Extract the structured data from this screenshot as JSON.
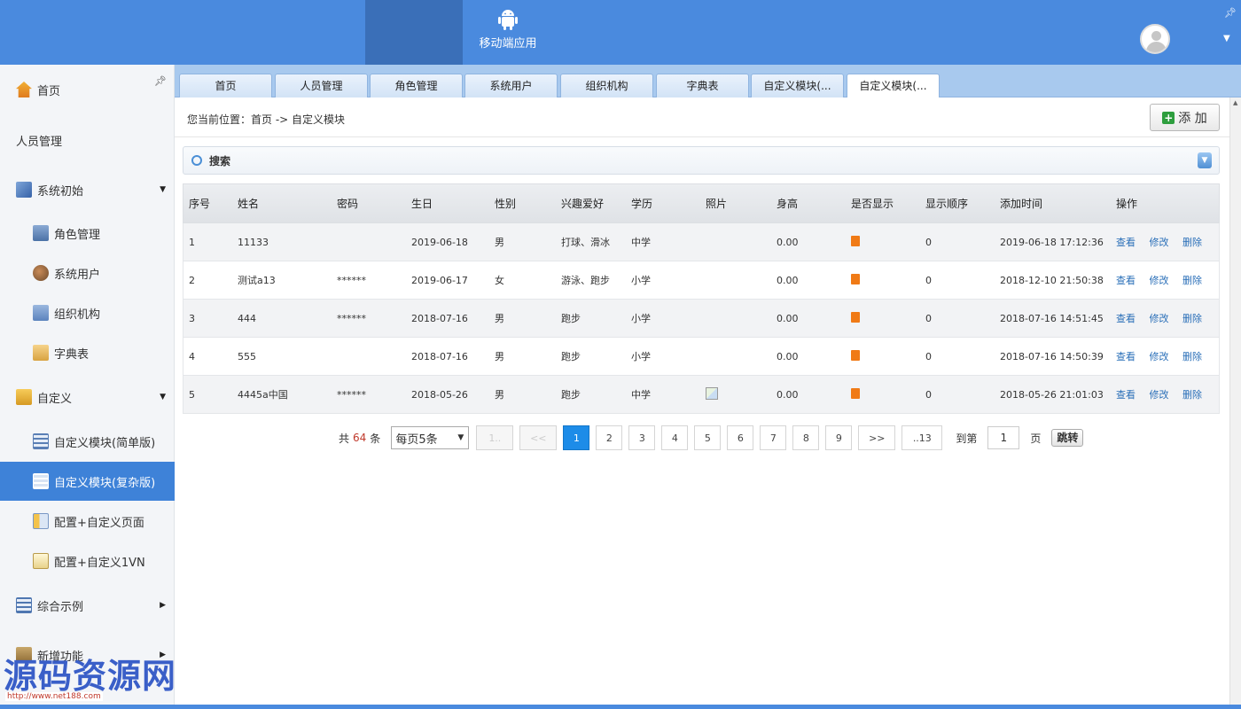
{
  "topbar": {
    "mobile_label": "移动端应用"
  },
  "sidebar": {
    "items": [
      {
        "label": "首页",
        "icon": "home-icon"
      },
      {
        "label": "人员管理",
        "icon": ""
      },
      {
        "label": "系统初始",
        "icon": "pen-icon"
      },
      {
        "label": "角色管理",
        "icon": "role-icon"
      },
      {
        "label": "系统用户",
        "icon": "user-icon"
      },
      {
        "label": "组织机构",
        "icon": "org-icon"
      },
      {
        "label": "字典表",
        "icon": "dict-icon"
      },
      {
        "label": "自定义",
        "icon": "custom-icon"
      },
      {
        "label": "自定义模块(简单版)",
        "icon": "table-icon"
      },
      {
        "label": "自定义模块(复杂版)",
        "icon": "table-icon"
      },
      {
        "label": "配置+自定义页面",
        "icon": "config-icon"
      },
      {
        "label": "配置+自定义1VN",
        "icon": "document-icon"
      },
      {
        "label": "综合示例",
        "icon": "table-icon"
      },
      {
        "label": "新增功能",
        "icon": "new-icon"
      }
    ],
    "active_index": 9
  },
  "watermark": {
    "text": "源码资源网",
    "url": "http://www.net188.com"
  },
  "tabs": [
    {
      "label": "首页"
    },
    {
      "label": "人员管理"
    },
    {
      "label": "角色管理"
    },
    {
      "label": "系统用户"
    },
    {
      "label": "组织机构"
    },
    {
      "label": "字典表"
    },
    {
      "label": "自定义模块(..."
    },
    {
      "label": "自定义模块(..."
    }
  ],
  "content": {
    "breadcrumb": "您当前位置：首页 -> 自定义模块",
    "add_label": "添 加",
    "search_label": "搜索"
  },
  "table": {
    "headers": [
      "序号",
      "姓名",
      "密码",
      "生日",
      "性别",
      "兴趣爱好",
      "学历",
      "照片",
      "身高",
      "是否显示",
      "显示顺序",
      "添加时间",
      "操作"
    ],
    "rows": [
      {
        "seq": "1",
        "name": "11133",
        "pwd": "",
        "bday": "2019-06-18",
        "sex": "男",
        "hobby": "打球、滑冰",
        "edu": "中学",
        "photo": false,
        "height": "0.00",
        "order": "0",
        "time": "2019-06-18 17:12:36"
      },
      {
        "seq": "2",
        "name": "测试a13",
        "pwd": "******",
        "bday": "2019-06-17",
        "sex": "女",
        "hobby": "游泳、跑步",
        "edu": "小学",
        "photo": false,
        "height": "0.00",
        "order": "0",
        "time": "2018-12-10 21:50:38"
      },
      {
        "seq": "3",
        "name": "444",
        "pwd": "******",
        "bday": "2018-07-16",
        "sex": "男",
        "hobby": "跑步",
        "edu": "小学",
        "photo": false,
        "height": "0.00",
        "order": "0",
        "time": "2018-07-16 14:51:45"
      },
      {
        "seq": "4",
        "name": "555",
        "pwd": "",
        "bday": "2018-07-16",
        "sex": "男",
        "hobby": "跑步",
        "edu": "小学",
        "photo": false,
        "height": "0.00",
        "order": "0",
        "time": "2018-07-16 14:50:39"
      },
      {
        "seq": "5",
        "name": "4445a中国",
        "pwd": "******",
        "bday": "2018-05-26",
        "sex": "男",
        "hobby": "跑步",
        "edu": "中学",
        "photo": true,
        "height": "0.00",
        "order": "0",
        "time": "2018-05-26 21:01:03"
      }
    ],
    "actions": {
      "view": "查看",
      "edit": "修改",
      "delete": "删除"
    }
  },
  "pager": {
    "total_prefix": "共",
    "total": "64",
    "total_suffix": "条",
    "page_size": "每页5条",
    "first": "1..",
    "prev": "<<",
    "pages": [
      "1",
      "2",
      "3",
      "4",
      "5",
      "6",
      "7",
      "8",
      "9"
    ],
    "current": "1",
    "next": ">>",
    "last": "..13",
    "goto_prefix": "到第",
    "goto_value": "1",
    "goto_suffix": "页",
    "jump_label": "跳转"
  },
  "colors": {
    "topbar": "#4a8ade",
    "active_sidebar": "#3e82d8",
    "pager_current": "#1d8ce8",
    "flag": "#f07a16",
    "link": "#2a6fb8"
  }
}
